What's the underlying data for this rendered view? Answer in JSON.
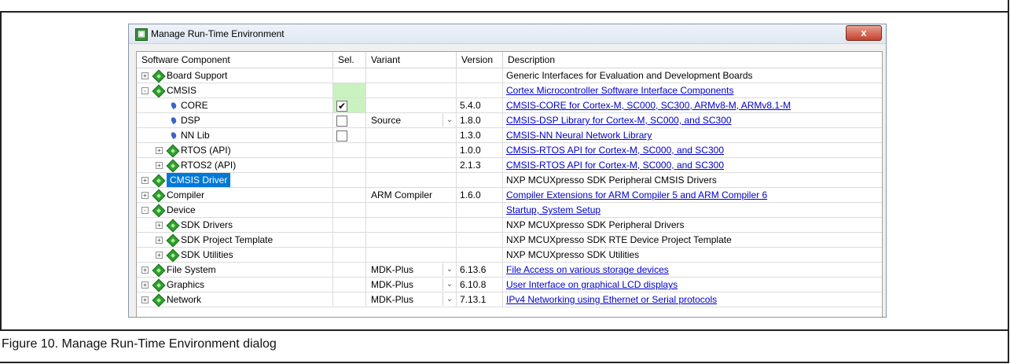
{
  "caption": "Figure 10. Manage Run-Time Environment dialog",
  "window": {
    "title": "Manage Run-Time Environment",
    "close_glyph": "x"
  },
  "columns": [
    "Software Component",
    "Sel.",
    "Variant",
    "Version",
    "Description"
  ],
  "rows": [
    {
      "name": "Board Support",
      "indent": 0,
      "toggle": "+",
      "icon": "component-icon",
      "sel": "",
      "variant": "",
      "version": "",
      "desc": "Generic Interfaces for Evaluation and Development Boards",
      "link": false
    },
    {
      "name": "CMSIS",
      "indent": 0,
      "toggle": "-",
      "icon": "component-icon",
      "sel": "green",
      "variant": "",
      "version": "",
      "desc": "Cortex Microcontroller Software Interface Components",
      "link": true
    },
    {
      "name": "CORE",
      "indent": 1,
      "toggle": "",
      "icon": "leaf-icon",
      "sel": "checked",
      "variant": "",
      "version": "5.4.0",
      "desc": "CMSIS-CORE for Cortex-M, SC000, SC300, ARMv8-M, ARMv8.1-M",
      "link": true
    },
    {
      "name": "DSP",
      "indent": 1,
      "toggle": "",
      "icon": "leaf-icon",
      "sel": "unchecked",
      "variant": "Source",
      "dropdown": true,
      "version": "1.8.0",
      "desc": "CMSIS-DSP Library for Cortex-M, SC000, and SC300",
      "link": true
    },
    {
      "name": "NN Lib",
      "indent": 1,
      "toggle": "",
      "icon": "leaf-icon",
      "sel": "unchecked",
      "variant": "",
      "version": "1.3.0",
      "desc": "CMSIS-NN Neural Network Library",
      "link": true
    },
    {
      "name": "RTOS (API)",
      "indent": 1,
      "toggle": "+",
      "icon": "component-icon",
      "sel": "",
      "variant": "",
      "version": "1.0.0",
      "desc": "CMSIS-RTOS API for Cortex-M, SC000, and SC300",
      "link": true
    },
    {
      "name": "RTOS2 (API)",
      "indent": 1,
      "toggle": "+",
      "icon": "component-icon",
      "sel": "",
      "variant": "",
      "version": "2.1.3",
      "desc": "CMSIS-RTOS API for Cortex-M, SC000, and SC300",
      "link": true
    },
    {
      "name": "CMSIS Driver",
      "indent": 0,
      "toggle": "+",
      "icon": "component-icon",
      "sel": "",
      "variant": "",
      "version": "",
      "desc": "NXP MCUXpresso SDK Peripheral CMSIS Drivers",
      "link": false,
      "selected": true
    },
    {
      "name": "Compiler",
      "indent": 0,
      "toggle": "+",
      "icon": "component-icon",
      "sel": "",
      "variant": "ARM Compiler",
      "version": "1.6.0",
      "desc": "Compiler Extensions for ARM Compiler 5 and ARM Compiler 6",
      "link": true
    },
    {
      "name": "Device",
      "indent": 0,
      "toggle": "-",
      "icon": "component-icon",
      "sel": "",
      "variant": "",
      "version": "",
      "desc": "Startup, System Setup",
      "link": true
    },
    {
      "name": "SDK Drivers",
      "indent": 1,
      "toggle": "+",
      "icon": "component-icon",
      "sel": "",
      "variant": "",
      "version": "",
      "desc": "NXP MCUXpresso SDK Peripheral Drivers",
      "link": false
    },
    {
      "name": "SDK Project Template",
      "indent": 1,
      "toggle": "+",
      "icon": "component-icon",
      "sel": "",
      "variant": "",
      "version": "",
      "desc": "NXP MCUXpresso SDK RTE Device Project Template",
      "link": false
    },
    {
      "name": "SDK Utilities",
      "indent": 1,
      "toggle": "+",
      "icon": "component-icon",
      "sel": "",
      "variant": "",
      "version": "",
      "desc": "NXP MCUXpresso SDK Utilities",
      "link": false
    },
    {
      "name": "File System",
      "indent": 0,
      "toggle": "+",
      "icon": "component-icon",
      "sel": "",
      "variant": "MDK-Plus",
      "dropdown": true,
      "version": "6.13.6",
      "desc": "File Access on various storage devices",
      "link": true
    },
    {
      "name": "Graphics",
      "indent": 0,
      "toggle": "+",
      "icon": "component-icon",
      "sel": "",
      "variant": "MDK-Plus",
      "dropdown": true,
      "version": "6.10.8",
      "desc": "User Interface on graphical LCD displays",
      "link": true
    },
    {
      "name": "Network",
      "indent": 0,
      "toggle": "+",
      "icon": "component-icon",
      "sel": "",
      "variant": "MDK-Plus",
      "dropdown": true,
      "version": "7.13.1",
      "desc": "IPv4 Networking using Ethernet or Serial protocols",
      "link": true
    }
  ],
  "colors": {
    "selection": "#0078d7",
    "link": "#0000cc",
    "sel_green": "#c9f2c0",
    "component_green": "#2fa02f"
  }
}
